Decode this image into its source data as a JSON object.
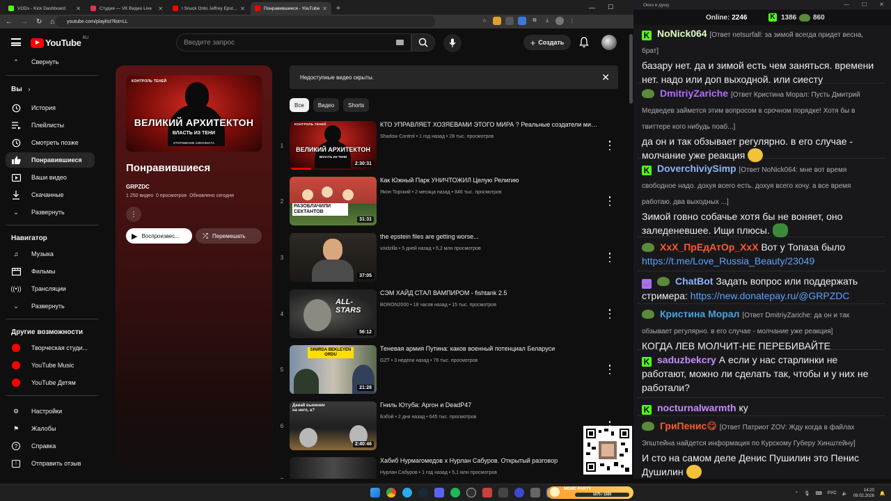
{
  "browser": {
    "tabs": [
      {
        "title": "VODs - Kick Dashboard",
        "color": "#53fc18",
        "active": false
      },
      {
        "title": "Студия — VK Видео Live",
        "color": "#e4304d",
        "active": false
      },
      {
        "title": "I Snuck Onto Jeffrey Epstein's Is",
        "color": "#ff0000",
        "active": false
      },
      {
        "title": "Понравившиеся - YouTube",
        "color": "#ff0000",
        "active": true
      }
    ],
    "url": "youtube.com/playlist?list=LL"
  },
  "yt_header": {
    "logo_text": "YouTube",
    "region": "RU",
    "search_placeholder": "Введите запрос",
    "create_label": "Создать"
  },
  "sidebar": {
    "collapse": "Свернуть",
    "you_heading": "Вы",
    "you_items": [
      "История",
      "Плейлисты",
      "Смотреть позже",
      "Понравившиеся",
      "Ваши видео",
      "Скачанные",
      "Развернуть"
    ],
    "nav_heading": "Навигатор",
    "nav_items": [
      "Музыка",
      "Фильмы",
      "Трансляции",
      "Развернуть"
    ],
    "other_heading": "Другие возможности",
    "other_items": [
      "Творческая студи...",
      "YouTube Music",
      "YouTube Детям"
    ],
    "settings_items": [
      "Настройки",
      "Жалобы",
      "Справка",
      "Отправить отзыв"
    ]
  },
  "playlist": {
    "thumb_tag": "КОНТРОЛЬ ТЕНЕЙ",
    "thumb_title": "ВЕЛИКИЙ АРХИТЕКТОН",
    "thumb_subtitle": "ВЛАСТЬ ИЗ ТЕНИ",
    "thumb_caption": "ОТКРОВЕНИЕ СИКОЛИСТА",
    "title": "Понравившиеся",
    "owner": "GRPZDC",
    "stat_videos": "1 250 видео",
    "stat_views": "0 просмотров",
    "stat_updated": "Обновлено сегодня",
    "play_label": "Воспроизвес...",
    "shuffle_label": "Перемешать"
  },
  "main": {
    "notice": "Недоступные видео скрыты.",
    "chips": [
      "Все",
      "Видео",
      "Shorts"
    ],
    "videos": [
      {
        "num": "1",
        "title": "КТО УПРАВЛЯЕТ ХОЗЯЕВАМИ ЭТОГО МИРА ? Реальные создатели мирового порядка",
        "channel": "Shadow Control",
        "age": "1 год назад",
        "views": "28 тыс. просмотров",
        "duration": "2:30:31",
        "thumb_text": "ВЕЛИКИЙ АРХИТЕКТОН",
        "thumb_sub": "ВЛАСТЬ ИЗ ТЕНИ",
        "progress": 0.25,
        "theme": "red"
      },
      {
        "num": "2",
        "title": "Как Южный Парк УНИЧТОЖИЛ Целую Религию",
        "channel": "Якон Торский",
        "age": "2 месяца назад",
        "views": "846 тыс. просмотров",
        "duration": "31:31",
        "thumb_text": "РАЗОБЛАЧИЛИ СЕКТАНТОВ",
        "thumb_sub": "",
        "progress": 0,
        "theme": "park"
      },
      {
        "num": "3",
        "title": "the epstein files are getting worse...",
        "channel": "voidzilla",
        "age": "5 дней назад",
        "views": "5,2 млн просмотров",
        "duration": "37:05",
        "thumb_text": "",
        "thumb_sub": "",
        "progress": 0,
        "theme": "man"
      },
      {
        "num": "4",
        "title": "СЭМ ХАЙД СТАЛ ВАМПИРОМ - fishtank 2.5",
        "channel": "BORON2000",
        "age": "18 часов назад",
        "views": "15 тыс. просмотров",
        "duration": "56:12",
        "thumb_text": "ALL-STARS",
        "thumb_sub": "",
        "progress": 0,
        "theme": "dark"
      },
      {
        "num": "5",
        "title": "Теневая армия Путина: каков военный потенциал Беларуси",
        "channel": "GZT",
        "age": "3 недели назад",
        "views": "76 тыс. просмотров",
        "duration": "21:28",
        "thumb_text": "SINIRDA BEKLEYEN ORDU",
        "thumb_sub": "",
        "progress": 0,
        "theme": "news"
      },
      {
        "num": "6",
        "title": "Гниль Ютуба: Аргон и DeadP47",
        "channel": "Бэбэй",
        "age": "2 дня назад",
        "views": "645 тыс. просмотров",
        "duration": "2:40:46",
        "thumb_text": "Давай выкинем на него, а?",
        "thumb_sub": "",
        "progress": 0,
        "theme": "knights"
      },
      {
        "num": "7",
        "title": "Хабиб Нурмагомедов х Нурлан Сабуров. Открытый разговор",
        "channel": "Нурлан Сабуров",
        "age": "1 год назад",
        "views": "5,1 млн просмотров",
        "duration": "",
        "thumb_text": "",
        "thumb_sub": "",
        "progress": 0,
        "theme": "bw"
      }
    ]
  },
  "chat": {
    "window_title": "Окно в душу",
    "online_label": "Online:",
    "online_count": "2246",
    "kick_count": "1386",
    "vk_count": "860",
    "messages": [
      {
        "badge": "kick",
        "user": "NoNick064",
        "color": "#e0ffbf",
        "reply": "[Ответ netsurfall: за зимой всегда придет весна, брат]",
        "text": "базару нет. да и зимой есть чем заняться. времени нет. надо или доп выходной. или сиесту",
        "link": ""
      },
      {
        "badge": "vk",
        "user": "DmitriyZariche",
        "color": "#b46bff",
        "reply": "[Ответ Кристина Морал: Пусть Дмитрий Медведев займется этим вопросом в срочном порядке! Хотя бы в твиттере кого нибудь поаб...]",
        "text": "да он и так обзывает регулярно. в его случае - молчание уже реакция",
        "link": ""
      },
      {
        "badge": "kick",
        "user": "DoverchiviySimp",
        "color": "#8fb4ff",
        "reply": "[Ответ NoNick064: мне вот время свободное надо. дохуя всего есть. дохуя всего хочу. а все время работаю. два выходных ...]",
        "text": "Зимой говно собачье хотя бы не воняет, оно заледеневшее. Ищи плюсы.",
        "link": ""
      },
      {
        "badge": "vk",
        "user": "ХхХ_ПрЕдАтОр_ХхХ",
        "color": "#ff5a2c",
        "reply": "",
        "text": "Вот у Топаза было",
        "link": "https://t.me/Love_Russia_Beauty/23049"
      },
      {
        "badge": "bot",
        "user": "ChatBot",
        "color": "#8fb4ff",
        "reply": "",
        "text": "Задать вопрос или поддержать стримера:",
        "link": "https://new.donatepay.ru/@GRPZDC"
      },
      {
        "badge": "vk",
        "user": "Кристина Морал",
        "color": "#4aa3df",
        "reply": "[Ответ DmitriyZariche: да он и так обзывает регулярно. в его случае - молчание уже реакция]",
        "text": "КОГДА ЛЕВ МОЛЧИТ-НЕ ПЕРЕБИВАЙТЕ",
        "link": ""
      },
      {
        "badge": "kick",
        "user": "saduzbekcry",
        "color": "#c58cff",
        "reply": "",
        "text": "А если у нас старлинки не работают, можно ли сделать так, чтобы и у них не работали?",
        "link": ""
      },
      {
        "badge": "kick",
        "user": "nocturnalwarmth",
        "color": "#c58cff",
        "reply": "",
        "text": "ку",
        "link": ""
      },
      {
        "badge": "vk",
        "user": "ГриПенис😋",
        "color": "#ff5a2c",
        "reply": "[Ответ Патриот ZOV: Жду когда в файлах Эпштейна найдется информация по Курскому Губеру Хинштейну]",
        "text": "И сто на самом деле Денис Пушилин это Пенис Душилин",
        "link": ""
      }
    ]
  },
  "taskbar": {
    "meme_label": "MEME PARTY",
    "meme_progress": "1075 / 1500",
    "lang": "РУС",
    "time": "14:20",
    "date": "09.02.2026"
  }
}
